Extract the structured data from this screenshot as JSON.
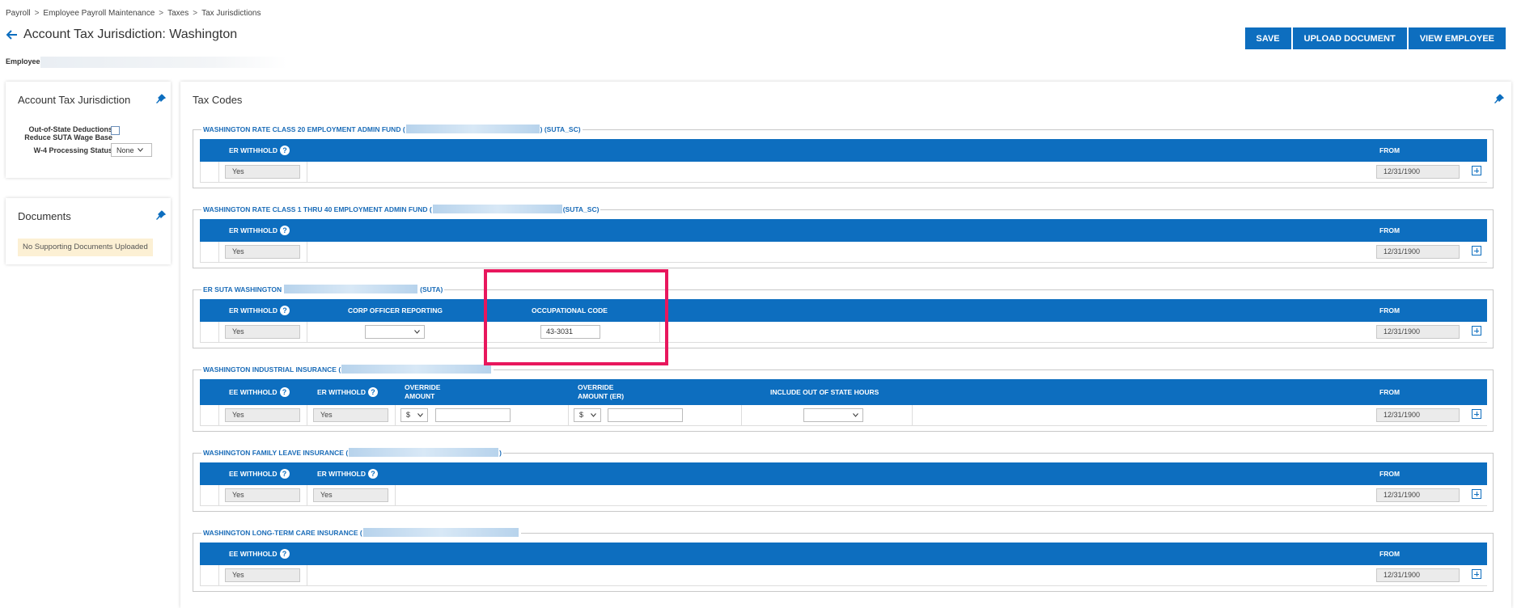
{
  "breadcrumb": [
    "Payroll",
    "Employee Payroll Maintenance",
    "Taxes",
    "Tax Jurisdictions"
  ],
  "page_title": "Account Tax Jurisdiction: Washington",
  "actions": {
    "save": "SAVE",
    "upload": "UPLOAD DOCUMENT",
    "view_employee": "VIEW EMPLOYEE"
  },
  "employee_label": "Employee",
  "account_panel": {
    "title": "Account Tax Jurisdiction",
    "oos_label_line1": "Out-of-State Deductions",
    "oos_label_line2": "Reduce SUTA Wage Base",
    "w4_label": "W-4 Processing Status",
    "w4_value": "None"
  },
  "documents_panel": {
    "title": "Documents",
    "notice": "No Supporting Documents Uploaded"
  },
  "tax_codes": {
    "title": "Tax Codes",
    "sections": [
      {
        "legend_pre": "WASHINGTON RATE CLASS 20 EMPLOYMENT ADMIN FUND (",
        "legend_post": ") (SUTA_SC)",
        "er_withhold_label": "ER WITHHOLD",
        "from_label": "FROM",
        "er_withhold": "Yes",
        "from": "12/31/1900"
      },
      {
        "legend_pre": "WASHINGTON RATE CLASS 1 THRU 40 EMPLOYMENT ADMIN FUND (",
        "legend_post": "(SUTA_SC)",
        "er_withhold_label": "ER WITHHOLD",
        "from_label": "FROM",
        "er_withhold": "Yes",
        "from": "12/31/1900"
      },
      {
        "legend_pre": "ER SUTA WASHINGTON",
        "legend_post": "(SUTA)",
        "er_withhold_label": "ER WITHHOLD",
        "corp_officer_label": "CORP OFFICER REPORTING",
        "occ_code_label": "OCCUPATIONAL CODE",
        "from_label": "FROM",
        "er_withhold": "Yes",
        "corp_officer": "",
        "occ_code": "43-3031",
        "from": "12/31/1900"
      },
      {
        "legend_pre": "WASHINGTON INDUSTRIAL INSURANCE (",
        "legend_post": "",
        "ee_withhold_label": "EE WITHHOLD",
        "er_withhold_label": "ER WITHHOLD",
        "override_label_1": "OVERRIDE",
        "override_label_2": "AMOUNT",
        "override_er_label_1": "OVERRIDE",
        "override_er_label_2": "AMOUNT (ER)",
        "include_oos_label": "INCLUDE OUT OF STATE HOURS",
        "from_label": "FROM",
        "ee_withhold": "Yes",
        "er_withhold": "Yes",
        "override_type": "$",
        "override_amount": "",
        "override_er_type": "$",
        "override_er_amount": "",
        "include_oos": "",
        "from": "12/31/1900"
      },
      {
        "legend_pre": "WASHINGTON FAMILY LEAVE INSURANCE (",
        "legend_post": ")",
        "ee_withhold_label": "EE WITHHOLD",
        "er_withhold_label": "ER WITHHOLD",
        "from_label": "FROM",
        "ee_withhold": "Yes",
        "er_withhold": "Yes",
        "from": "12/31/1900"
      },
      {
        "legend_pre": "WASHINGTON LONG-TERM CARE INSURANCE (",
        "legend_post": "",
        "ee_withhold_label": "EE WITHHOLD",
        "from_label": "FROM",
        "ee_withhold": "Yes",
        "from": "12/31/1900"
      }
    ]
  },
  "help_glyph": "?",
  "colors": {
    "primary": "#0d6ebf",
    "highlight": "#e8175d",
    "notice_bg": "#fcf0d4"
  }
}
